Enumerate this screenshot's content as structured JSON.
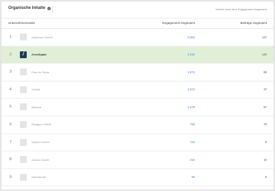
{
  "header": {
    "title": "Organische Inhalte",
    "sort_label": "Sortiert nach dem Engagement insgesamt"
  },
  "columns": {
    "company": "Unternehmensseite",
    "engagement": "Engagement insgesamt",
    "posts": "Beiträge insgesamt"
  },
  "rows": [
    {
      "rank": "1",
      "name": "Adanesse GmbH",
      "engagement": "3.464",
      "posts": "147"
    },
    {
      "rank": "2",
      "name": "ZeenDigital",
      "engagement": "2.410",
      "posts": "120"
    },
    {
      "rank": "3",
      "name": "Peer for Texas",
      "engagement": "1.874",
      "posts": "86"
    },
    {
      "rank": "4",
      "name": "Velotta",
      "engagement": "1.672",
      "posts": "27"
    },
    {
      "rank": "5",
      "name": "Miscara",
      "engagement": "1.479",
      "posts": "57"
    },
    {
      "rank": "6",
      "name": "Skuggen GmbH",
      "engagement": "746",
      "posts": "70"
    },
    {
      "rank": "7",
      "name": "Vabrum GmbH",
      "engagement": "744",
      "posts": "9"
    },
    {
      "rank": "8",
      "name": "Aranon GmbH",
      "engagement": "210",
      "posts": "10"
    },
    {
      "rank": "9",
      "name": "edenstunde",
      "engagement": "96",
      "posts": "8"
    }
  ],
  "highlight_color": "#e1efd8",
  "accent_color": "#4a7bc6"
}
